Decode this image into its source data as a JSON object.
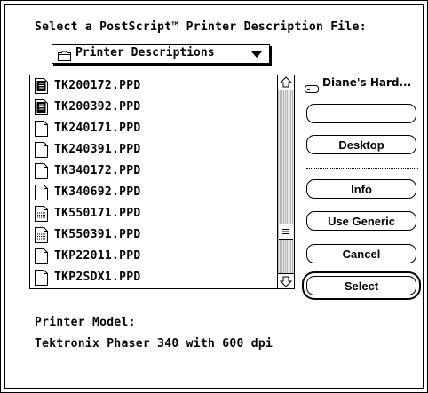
{
  "dialog": {
    "prompt": "Select a PostScript™ Printer Description File:",
    "folder_popup": {
      "label": "Printer Descriptions",
      "icon": "folder-icon"
    },
    "files": [
      {
        "name": "TK200172.PPD",
        "icon": "ppd-document-icon"
      },
      {
        "name": "TK200392.PPD",
        "icon": "ppd-document-icon"
      },
      {
        "name": "TK240171.PPD",
        "icon": "blank-document-icon"
      },
      {
        "name": "TK240391.PPD",
        "icon": "blank-document-icon"
      },
      {
        "name": "TK340172.PPD",
        "icon": "blank-document-icon"
      },
      {
        "name": "TK340692.PPD",
        "icon": "blank-document-icon"
      },
      {
        "name": "TK550171.PPD",
        "icon": "text-document-icon"
      },
      {
        "name": "TK550391.PPD",
        "icon": "text-document-icon"
      },
      {
        "name": "TKP22011.PPD",
        "icon": "blank-document-icon"
      },
      {
        "name": "TKP2SDX1.PPD",
        "icon": "blank-document-icon"
      }
    ],
    "disk": {
      "label": "Diane's Hard...",
      "icon": "hard-disk-icon"
    },
    "buttons": {
      "eject": "",
      "desktop": "Desktop",
      "info": "Info",
      "use_generic": "Use Generic",
      "cancel": "Cancel",
      "select": "Select"
    },
    "printer_model_label": "Printer Model:",
    "printer_model_value": "Tektronix Phaser 340 with 600 dpi"
  },
  "colors": {
    "background": "#ffffff",
    "foreground": "#000000"
  }
}
